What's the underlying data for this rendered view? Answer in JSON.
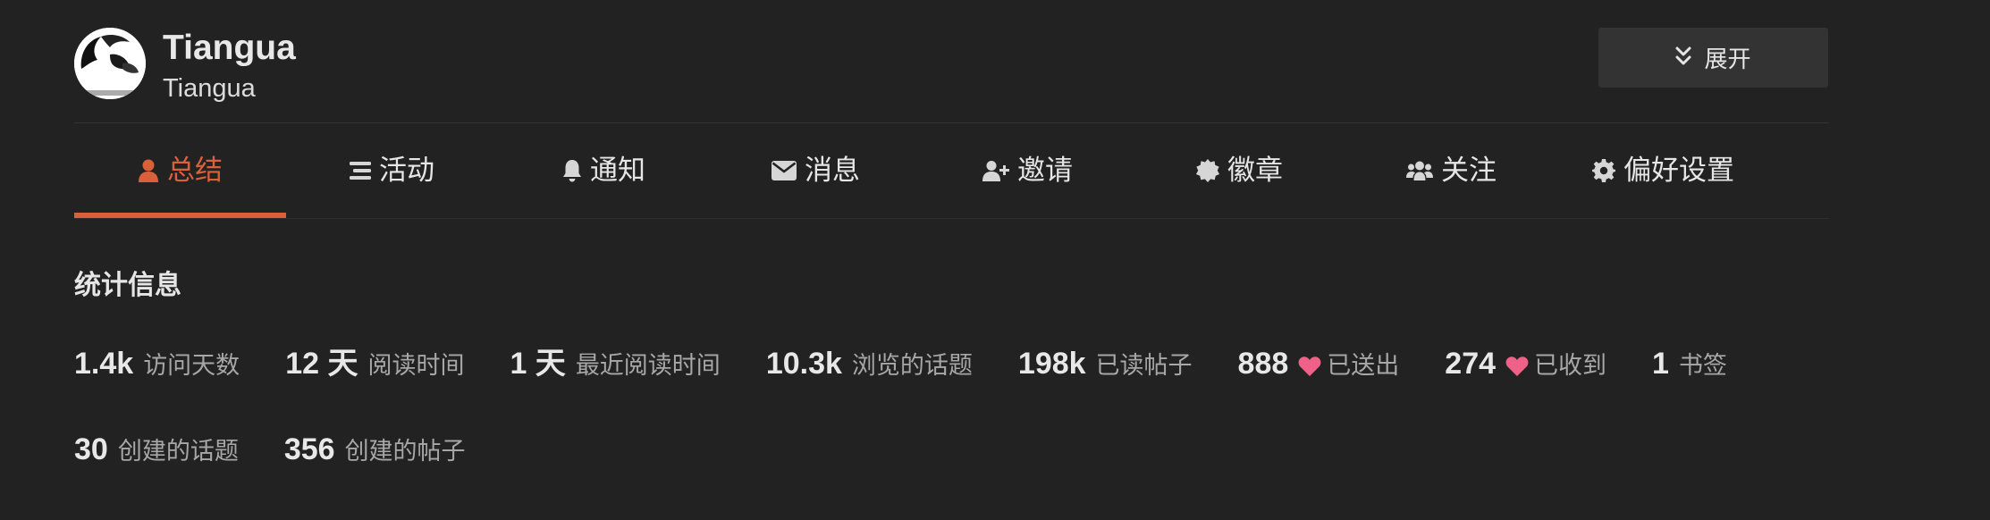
{
  "header": {
    "username": "Tiangua",
    "full_name": "Tiangua",
    "expand_label": "展开"
  },
  "nav": {
    "active_index": 0,
    "items": [
      {
        "label": "总结",
        "icon": "user-icon"
      },
      {
        "label": "活动",
        "icon": "list-icon"
      },
      {
        "label": "通知",
        "icon": "bell-icon"
      },
      {
        "label": "消息",
        "icon": "envelope-icon"
      },
      {
        "label": "邀请",
        "icon": "user-plus-icon"
      },
      {
        "label": "徽章",
        "icon": "certificate-icon"
      },
      {
        "label": "关注",
        "icon": "users-icon"
      },
      {
        "label": "偏好设置",
        "icon": "gear-icon"
      }
    ]
  },
  "stats": {
    "title": "统计信息",
    "items": [
      {
        "value": "1.4k",
        "label": "访问天数"
      },
      {
        "value": "12 天",
        "label": "阅读时间"
      },
      {
        "value": "1 天",
        "label": "最近阅读时间"
      },
      {
        "value": "10.3k",
        "label": "浏览的话题"
      },
      {
        "value": "198k",
        "label": "已读帖子"
      },
      {
        "value": "888",
        "label": "已送出",
        "icon": "heart-icon"
      },
      {
        "value": "274",
        "label": "已收到",
        "icon": "heart-icon"
      },
      {
        "value": "1",
        "label": "书签"
      },
      {
        "value": "30",
        "label": "创建的话题"
      },
      {
        "value": "356",
        "label": "创建的帖子"
      }
    ]
  },
  "colors": {
    "background": "#222222",
    "accent": "#d8603a",
    "heart": "#ef6189",
    "button_bg": "#333333"
  }
}
